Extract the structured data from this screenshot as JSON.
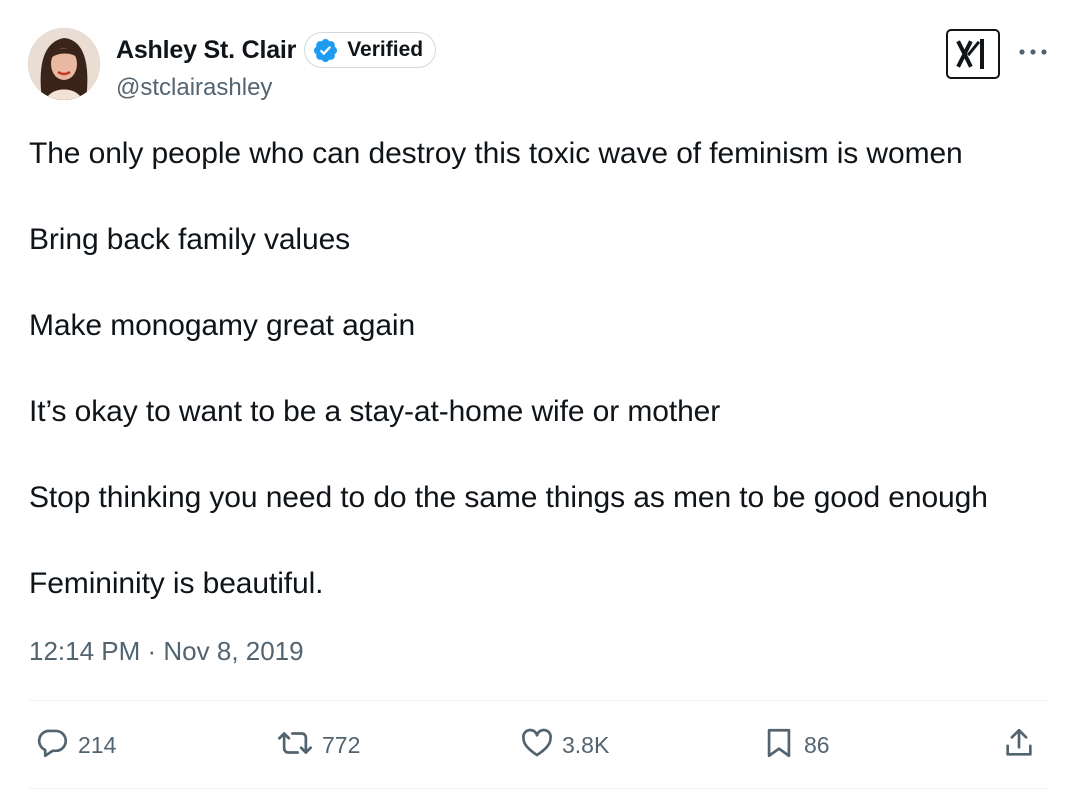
{
  "author": {
    "display_name": "Ashley St. Clair",
    "verified_label": "Verified",
    "handle": "@stclairashley"
  },
  "tweet": {
    "paragraphs": [
      "The only people who can destroy this toxic wave of feminism is women",
      "Bring back family values",
      "Make monogamy great again",
      "It’s okay to want to be a stay-at-home wife or mother",
      "Stop thinking you need to do the same things as men to be good enough",
      "Femininity is beautiful."
    ],
    "timestamp": "12:14 PM · Nov 8, 2019"
  },
  "actions": {
    "replies": "214",
    "reposts": "772",
    "likes": "3.8K",
    "bookmarks": "86"
  },
  "icons": {
    "verified": "verified-badge-icon",
    "logo": "x-logo-icon",
    "more": "more-options-icon",
    "reply": "reply-icon",
    "repost": "repost-icon",
    "like": "like-icon",
    "bookmark": "bookmark-icon",
    "share": "share-icon"
  },
  "colors": {
    "text": "#0f1419",
    "secondary": "#536471",
    "verified_blue": "#1d9bf0",
    "border": "#cfd9de"
  }
}
